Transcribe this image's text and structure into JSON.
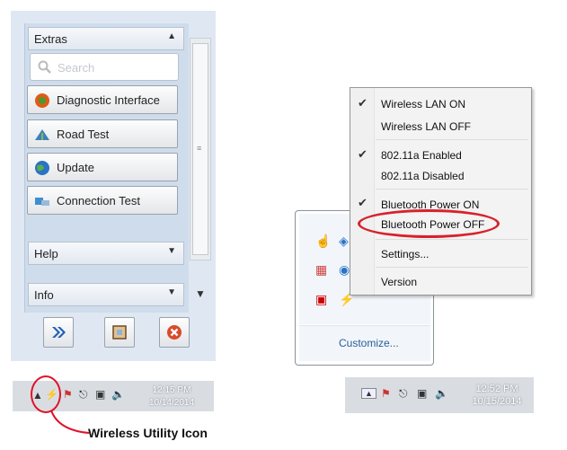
{
  "sidebar": {
    "extras_header": "Extras",
    "search_placeholder": "Search",
    "buttons": [
      {
        "label": "Diagnostic Interface"
      },
      {
        "label": "Road Test"
      },
      {
        "label": "Update"
      },
      {
        "label": "Connection Test"
      }
    ],
    "help_header": "Help",
    "info_header": "Info"
  },
  "left_tray": {
    "time": "12:15 PM",
    "date": "10/14/2014"
  },
  "callout": {
    "label": "Wireless Utility Icon",
    "color": "#e0122a"
  },
  "tray_overflow": {
    "customize_link": "Customize..."
  },
  "context_menu": {
    "items": [
      {
        "label": "Wireless LAN ON",
        "checked": true
      },
      {
        "label": "Wireless LAN OFF",
        "checked": false
      },
      {
        "label": "802.11a Enabled",
        "checked": true
      },
      {
        "label": "802.11a Disabled",
        "checked": false
      },
      {
        "label": "Bluetooth Power ON",
        "checked": true
      },
      {
        "label": "Bluetooth Power OFF",
        "checked": false,
        "highlighted": true
      },
      {
        "label": "Settings...",
        "checked": false
      },
      {
        "label": "Version",
        "checked": false
      }
    ]
  },
  "right_tray": {
    "time": "12:52 PM",
    "date": "10/15/2014"
  },
  "icons": {
    "check": "checkmark-icon",
    "wireless_utility": "wireless-utility-icon"
  }
}
